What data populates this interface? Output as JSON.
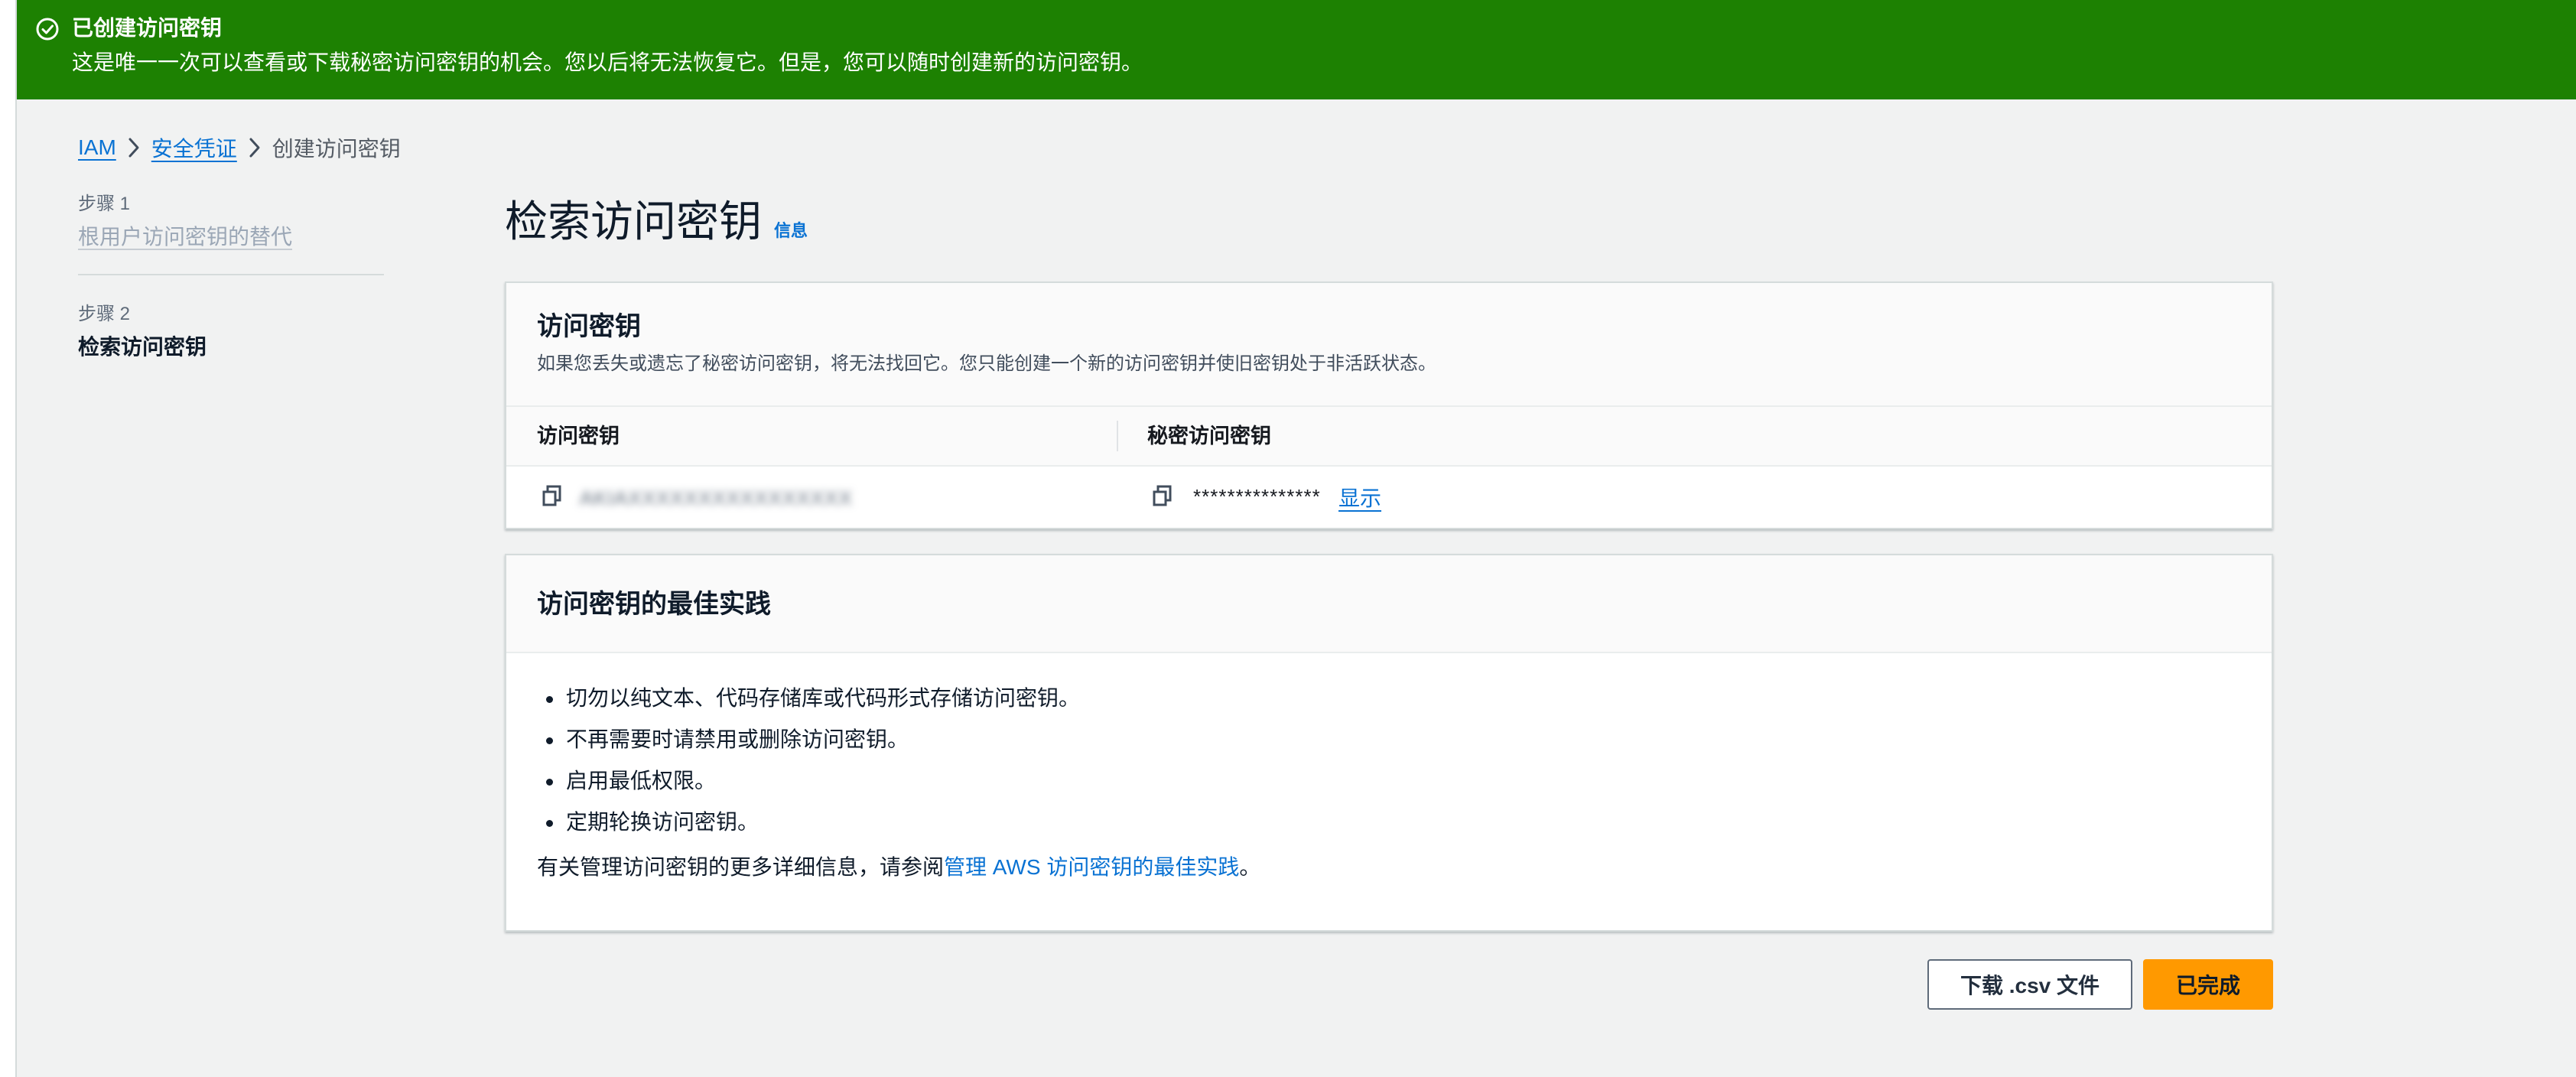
{
  "flash": {
    "title": "已创建访问密钥",
    "message": "这是唯一一次可以查看或下载秘密访问密钥的机会。您以后将无法恢复它。但是，您可以随时创建新的访问密钥。",
    "color": "#1d8102"
  },
  "breadcrumb": {
    "items": [
      "IAM",
      "安全凭证",
      "创建访问密钥"
    ]
  },
  "steps": [
    {
      "caption": "步骤 1",
      "title": "根用户访问密钥的替代"
    },
    {
      "caption": "步骤 2",
      "title": "检索访问密钥"
    }
  ],
  "page": {
    "title": "检索访问密钥",
    "info_label": "信息"
  },
  "access_keys": {
    "title": "访问密钥",
    "description": "如果您丢失或遗忘了秘密访问密钥，将无法找回它。您只能创建一个新的访问密钥并使旧密钥处于非活跃状态。",
    "columns": [
      "访问密钥",
      "秘密访问密钥"
    ],
    "row": {
      "access_key_id": "AKIAXXXXXXXXXXXXXXXX",
      "secret_masked": "***************",
      "show_label": "显示"
    }
  },
  "best_practices": {
    "title": "访问密钥的最佳实践",
    "items": [
      "切勿以纯文本、代码存储库或代码形式存储访问密钥。",
      "不再需要时请禁用或删除访问密钥。",
      "启用最低权限。",
      "定期轮换访问密钥。"
    ],
    "more_prefix": "有关管理访问密钥的更多详细信息，请参阅",
    "more_link": "管理 AWS 访问密钥的最佳实践",
    "more_suffix": "。"
  },
  "actions": {
    "download_csv": "下载 .csv 文件",
    "done": "已完成",
    "primary_color": "#ff9900"
  },
  "icons": {
    "flash": "check-circle-icon",
    "breadcrumb_sep": "chevron-right-icon",
    "copy": "copy-icon"
  }
}
